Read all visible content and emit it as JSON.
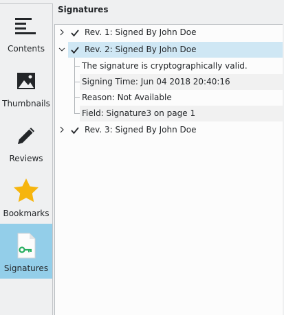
{
  "sidebar": {
    "items": [
      {
        "label": "Contents",
        "icon": "contents-icon"
      },
      {
        "label": "Thumbnails",
        "icon": "thumbnails-icon"
      },
      {
        "label": "Reviews",
        "icon": "reviews-icon"
      },
      {
        "label": "Bookmarks",
        "icon": "bookmarks-icon"
      },
      {
        "label": "Signatures",
        "icon": "signatures-icon"
      }
    ],
    "active": "Signatures"
  },
  "panel": {
    "title": "Signatures"
  },
  "tree": {
    "revisions": [
      {
        "label": "Rev. 1: Signed By John Doe",
        "expanded": false
      },
      {
        "label": "Rev. 2: Signed By John Doe",
        "expanded": true,
        "selected": true,
        "details": [
          "The signature is cryptographically valid.",
          "Signing Time: Jun 04 2018 20:40:16",
          "Reason: Not Available",
          "Field: Signature3 on page 1"
        ]
      },
      {
        "label": "Rev. 3: Signed By John Doe",
        "expanded": false
      }
    ]
  },
  "colors": {
    "active_sidebar_bg": "#93cee9",
    "selected_row_bg": "#cfe7f4",
    "bookmark_star": "#f6b50e",
    "key_icon": "#27ae60"
  }
}
